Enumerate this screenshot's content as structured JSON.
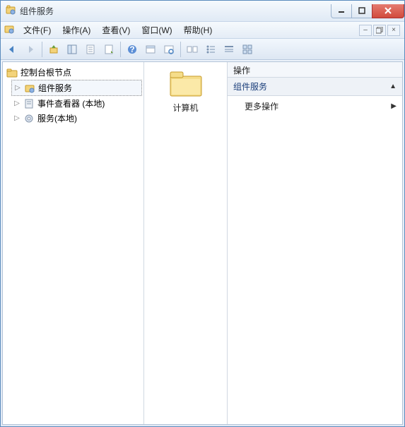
{
  "window": {
    "title": "组件服务"
  },
  "menu": {
    "file": "文件(F)",
    "action": "操作(A)",
    "view": "查看(V)",
    "window": "窗口(W)",
    "help": "帮助(H)"
  },
  "tree": {
    "root": "控制台根节点",
    "items": [
      {
        "label": "组件服务",
        "icon": "component-icon",
        "selected": true
      },
      {
        "label": "事件查看器 (本地)",
        "icon": "event-icon",
        "selected": false
      },
      {
        "label": "服务(本地)",
        "icon": "gear-icon",
        "selected": false
      }
    ]
  },
  "center": {
    "item_label": "计算机"
  },
  "actions": {
    "header": "操作",
    "section": "组件服务",
    "more": "更多操作"
  }
}
